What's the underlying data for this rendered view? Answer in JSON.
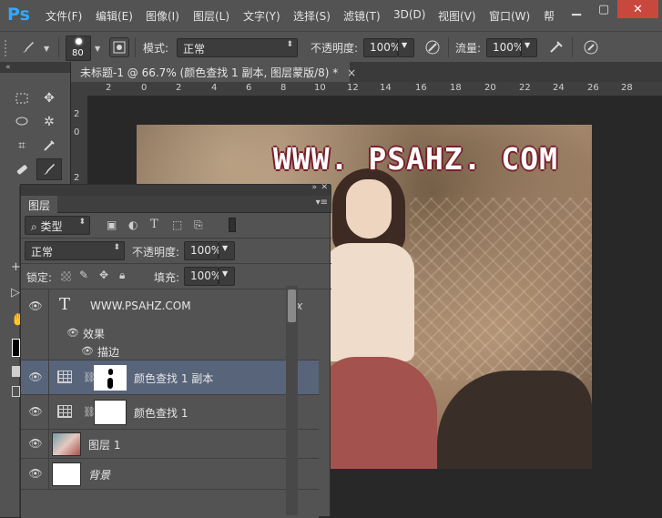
{
  "app": {
    "logo": "Ps"
  },
  "menu": [
    "文件(F)",
    "编辑(E)",
    "图像(I)",
    "图层(L)",
    "文字(Y)",
    "选择(S)",
    "滤镜(T)",
    "3D(D)",
    "视图(V)",
    "窗口(W)",
    "帮"
  ],
  "window_controls": {
    "minimize": "▁",
    "maximize": "▢",
    "close": "✕"
  },
  "options": {
    "brush_size": "80",
    "mode_label": "模式:",
    "mode_value": "正常",
    "opacity_label": "不透明度:",
    "opacity_value": "100%",
    "flow_label": "流量:",
    "flow_value": "100%"
  },
  "document": {
    "tab_title": "未标题-1 @ 66.7% (颜色查找 1 副本, 图层蒙版/8) *",
    "close": "×"
  },
  "rulers": {
    "h_ticks": [
      "2",
      "0",
      "2",
      "4",
      "6",
      "8",
      "10",
      "12",
      "14",
      "16",
      "18",
      "20",
      "22",
      "24",
      "26",
      "28"
    ],
    "v_ticks": [
      "2",
      "0",
      "2",
      "4",
      "6"
    ]
  },
  "canvas": {
    "watermark": "WWW. PSAHZ. COM"
  },
  "layers_panel": {
    "tab": "图层",
    "filter_label": "类型",
    "blend_mode": "正常",
    "opacity_label": "不透明度:",
    "opacity_value": "100%",
    "lock_label": "锁定:",
    "fill_label": "填充:",
    "fill_value": "100%",
    "layers": [
      {
        "name": "WWW.PSAHZ.COM",
        "type": "text",
        "fx": "fx"
      },
      {
        "name": "效果",
        "type": "effects"
      },
      {
        "name": "描边",
        "type": "effect"
      },
      {
        "name": "颜色查找 1 副本",
        "type": "adjustment",
        "selected": true
      },
      {
        "name": "颜色查找 1",
        "type": "adjustment"
      },
      {
        "name": "图层 1",
        "type": "pixel"
      },
      {
        "name": "背景",
        "type": "background"
      }
    ]
  },
  "colors": {
    "accent": "#31a8ff",
    "selected_row": "#58647a",
    "panel": "#535353",
    "close": "#c9483d"
  }
}
